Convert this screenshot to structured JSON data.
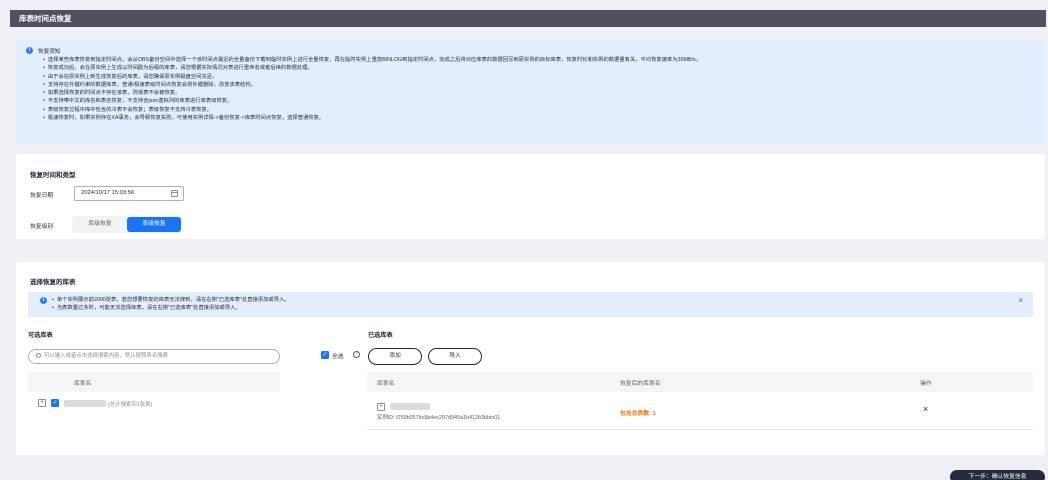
{
  "header": {
    "title": "库表时间点恢复"
  },
  "notice": {
    "title": "恢复须知",
    "items": [
      "选择某些库表恢复到指定时间点，会从OBS备份空间中选择一个该时间点最近的全量备份下载到临时实例上进行全量恢复，再在临时实例上重放BINLOG到指定时间点，完成之后将对应库表的数据回写到原实例的目标库表，恢复时长和实例的数据量有关，平均恢复速率为35MB/s。",
      "恢复成功后，会在原实例上生成以时间戳为后缀的库表，请您根据实际情况对表进行重命名或者后续的数据处理。",
      "由于会在原实例上新生成恢复后的库表，请您确保原实例磁盘空间充足。",
      "支持存在外键约束的数据库表，普通/极速表级时间点恢复会将外键删除，改变该表结构。",
      "如果选择恢复的时间点不存在该表，则该表不会被恢复。",
      "不支持带中文的库名和表名恢复，不支持含json虚拟列的库表进行库表级恢复。",
      "表级恢复过程中库中包含的冷表不会恢复；表级恢复不支持冷表恢复。",
      "极速恢复时，如果实例存在XA事务，会导致恢复失败。可使用实例详情->备份恢复->库表时间点恢复，选择普通恢复。"
    ]
  },
  "restore_settings": {
    "title": "恢复时间和类型",
    "date_label": "恢复日期",
    "date_value": "2024/10/17 15:03:56",
    "level_label": "恢复级别",
    "levels": [
      "库级恢复",
      "表级恢复"
    ],
    "selected_level": "表级恢复"
  },
  "table_select": {
    "title": "选择恢复的库表",
    "alert": [
      "单个实例展示前2000张表，若您想要恢复的库表无法搜到，请在右侧\"已选库表\"处直接添加或导入。",
      "当表数量过多时，可能无法选择库表，请在右侧\"已选库表\"处直接添加或导入。"
    ],
    "close_symbol": "×",
    "available": {
      "title": "可选库表",
      "search_placeholder": "可以输入或者点击选择搜索内容，默认按照表名搜索",
      "select_all_label": "全选",
      "column_header": "库表名",
      "row_hint": "(总计搜索到1张表)"
    },
    "selected": {
      "title": "已选库表",
      "add_label": "添加",
      "import_label": "导入",
      "columns": [
        "库表名",
        "恢复后的库表名",
        "操作"
      ],
      "instance_id": "实例ID: f259b057bc8b4ec297d945a1b412b3bbin01",
      "table_count": "包含总表数: 1",
      "delete_symbol": "×"
    }
  },
  "footer": {
    "next_label": "下一步：确认恢复信息"
  }
}
